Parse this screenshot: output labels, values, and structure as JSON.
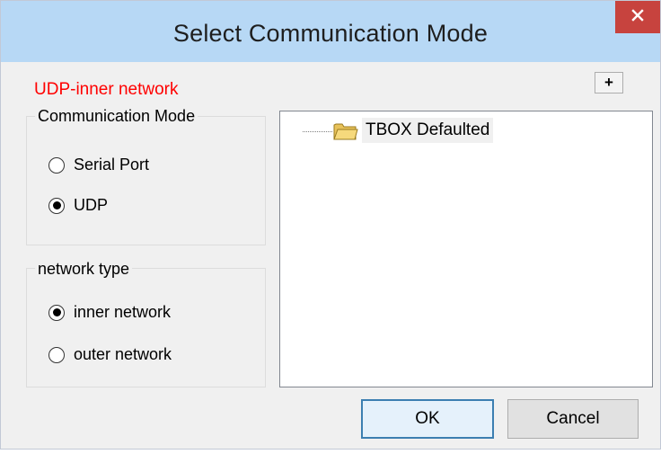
{
  "window": {
    "title": "Select Communication Mode"
  },
  "status_label": "UDP-inner network",
  "add_button_label": "+",
  "communication_mode": {
    "legend": "Communication Mode",
    "options": [
      {
        "label": "Serial Port",
        "checked": false
      },
      {
        "label": "UDP",
        "checked": true
      }
    ]
  },
  "network_type": {
    "legend": "network type",
    "options": [
      {
        "label": "inner network",
        "checked": true
      },
      {
        "label": "outer network",
        "checked": false
      }
    ]
  },
  "tree": {
    "items": [
      {
        "label": "TBOX Defaulted",
        "icon": "folder-icon"
      }
    ]
  },
  "buttons": {
    "ok": "OK",
    "cancel": "Cancel"
  },
  "colors": {
    "titlebar": "#b7d8f5",
    "close": "#c7433e",
    "status_text": "#ff0000",
    "default_button_border": "#3c7fb1"
  }
}
